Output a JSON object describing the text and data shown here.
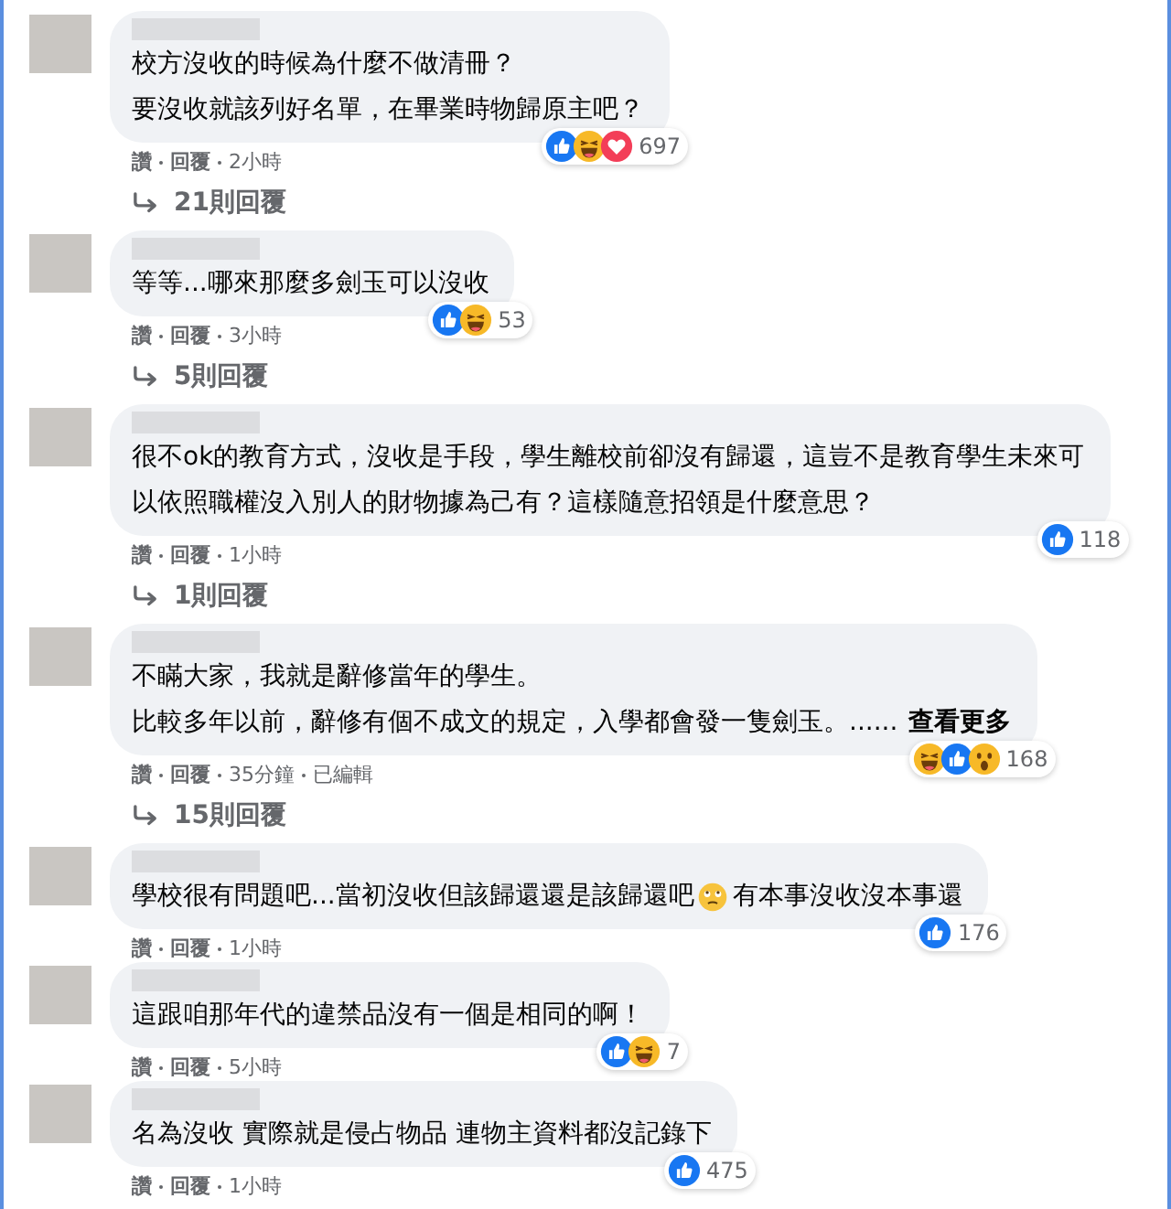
{
  "comments": [
    {
      "lines": [
        [
          {
            "kind": "text",
            "text": "校方沒收的時候為什麼不做清冊？"
          }
        ],
        [
          {
            "kind": "text",
            "text": "要沒收就該列好名單，在畢業時物歸原主吧？"
          }
        ]
      ],
      "reactions": [
        {
          "kind": "like"
        },
        {
          "kind": "haha"
        },
        {
          "kind": "love"
        }
      ],
      "reaction_count": "697",
      "actions": [
        "讚",
        "回覆"
      ],
      "time": "2小時",
      "replies": "21則回覆"
    },
    {
      "lines": [
        [
          {
            "kind": "text",
            "text": "等等...哪來那麼多劍玉可以沒收"
          }
        ]
      ],
      "reactions": [
        {
          "kind": "like"
        },
        {
          "kind": "haha"
        }
      ],
      "reaction_count": "53",
      "actions": [
        "讚",
        "回覆"
      ],
      "time": "3小時",
      "replies": "5則回覆"
    },
    {
      "lines": [
        [
          {
            "kind": "text",
            "text": "很不ok的教育方式，沒收是手段，學生離校前卻沒有歸還，這豈不是教育學生未來可"
          }
        ],
        [
          {
            "kind": "text",
            "text": "以依照職權沒入別人的財物據為己有？這樣隨意招領是什麼意思？"
          }
        ]
      ],
      "reactions": [
        {
          "kind": "like"
        }
      ],
      "reaction_count": "118",
      "actions": [
        "讚",
        "回覆"
      ],
      "time": "1小時",
      "replies": "1則回覆"
    },
    {
      "lines": [
        [
          {
            "kind": "text",
            "text": "不瞞大家，我就是辭修當年的學生。"
          }
        ],
        [
          {
            "kind": "text",
            "text": "比較多年以前，辭修有個不成文的規定，入學都會發一隻劍玉。......"
          },
          {
            "kind": "link",
            "text": "查看更多"
          }
        ]
      ],
      "reactions": [
        {
          "kind": "haha"
        },
        {
          "kind": "like"
        },
        {
          "kind": "wow"
        }
      ],
      "reaction_count": "168",
      "actions": [
        "讚",
        "回覆"
      ],
      "time": "35分鐘",
      "edited": "已編輯",
      "replies": "15則回覆"
    },
    {
      "lines": [
        [
          {
            "kind": "text",
            "text": "學校很有問題吧...當初沒收但該歸還還是該歸還吧"
          },
          {
            "kind": "emoji"
          },
          {
            "kind": "text",
            "text": "有本事沒收沒本事還"
          }
        ]
      ],
      "reactions": [
        {
          "kind": "like"
        }
      ],
      "reaction_count": "176",
      "actions": [
        "讚",
        "回覆"
      ],
      "time": "1小時"
    },
    {
      "lines": [
        [
          {
            "kind": "text",
            "text": "這跟咱那年代的違禁品沒有一個是相同的啊！"
          }
        ]
      ],
      "reactions": [
        {
          "kind": "like"
        },
        {
          "kind": "haha"
        }
      ],
      "reaction_count": "7",
      "actions": [
        "讚",
        "回覆"
      ],
      "time": "5小時"
    },
    {
      "lines": [
        [
          {
            "kind": "text",
            "text": "名為沒收 實際就是侵占物品 連物主資料都沒記錄下"
          }
        ]
      ],
      "reactions": [
        {
          "kind": "like"
        }
      ],
      "reaction_count": "475",
      "actions": [
        "讚",
        "回覆"
      ],
      "time": "1小時"
    }
  ]
}
